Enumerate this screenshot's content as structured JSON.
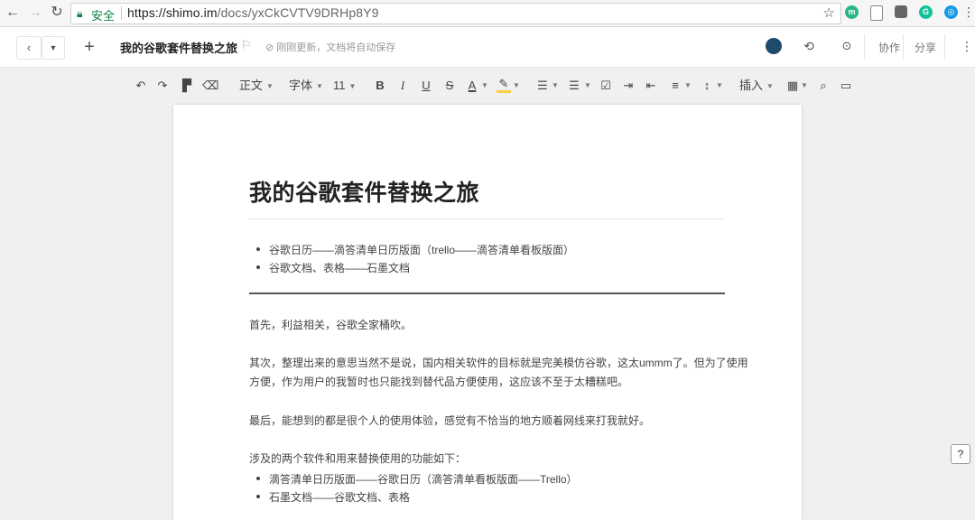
{
  "browser": {
    "secure_label": "安全",
    "url_host": "https://shimo.im",
    "url_path": "/docs/yxCkCVTV9DRHp8Y9",
    "extensions": [
      {
        "name": "m",
        "color": "#2bb58a"
      },
      {
        "name": "g",
        "color": "#15c39a"
      },
      {
        "name": "o",
        "color": "#1a9ae6"
      }
    ]
  },
  "header": {
    "title": "我的谷歌套件替换之旅",
    "save_status": "刚刚更新，文档将自动保存",
    "collaborate_label": "协作",
    "share_label": "分享"
  },
  "toolbar": {
    "style_label": "正文",
    "font_label": "字体",
    "size_label": "11",
    "insert_label": "插入"
  },
  "doc": {
    "heading": "我的谷歌套件替换之旅",
    "list1": [
      "谷歌日历——滴答清单日历版面（trello——滴答清单看板版面）",
      "谷歌文档、表格——石墨文档"
    ],
    "para1": "首先，利益相关，谷歌全家桶吹。",
    "para2_line1": "其次，整理出来的意思当然不是说，国内相关软件的目标就是完美模仿谷歌，这太ummm了。但为了使用",
    "para2_line2": "方便，作为用户的我暂时也只能找到替代品方便使用，这应该不至于太糟糕吧。",
    "para3": "最后，能想到的都是很个人的使用体验，感觉有不恰当的地方顺着网线来打我就好。",
    "para4": "涉及的两个软件和用来替换使用的功能如下：",
    "list2": [
      "滴答清单日历版面——谷歌日历（滴答清单看板版面——Trello）",
      "石墨文档——谷歌文档、表格"
    ]
  },
  "help_label": "?"
}
